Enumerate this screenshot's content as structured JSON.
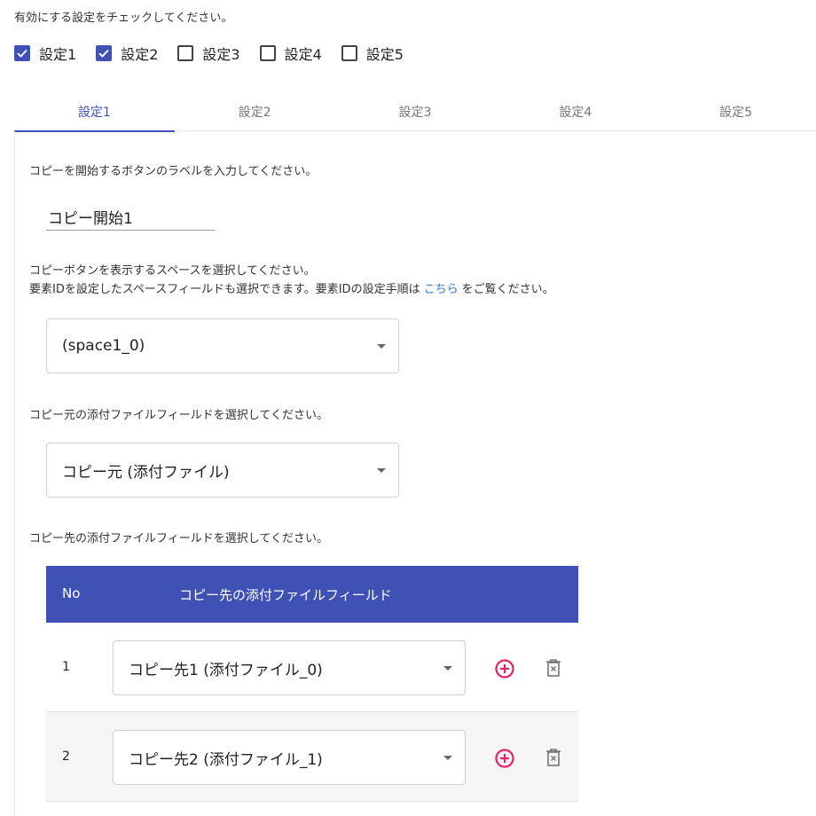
{
  "intro": "有効にする設定をチェックしてください。",
  "settings_checks": [
    {
      "label": "設定1",
      "checked": true
    },
    {
      "label": "設定2",
      "checked": true
    },
    {
      "label": "設定3",
      "checked": false
    },
    {
      "label": "設定4",
      "checked": false
    },
    {
      "label": "設定5",
      "checked": false
    }
  ],
  "tabs": [
    {
      "label": "設定1",
      "active": true
    },
    {
      "label": "設定2",
      "active": false
    },
    {
      "label": "設定3",
      "active": false
    },
    {
      "label": "設定4",
      "active": false
    },
    {
      "label": "設定5",
      "active": false
    }
  ],
  "form": {
    "button_label_prompt": "コピーを開始するボタンのラベルを入力してください。",
    "button_label_value": "コピー開始1",
    "space_prompt_line1": "コピーボタンを表示するスペースを選択してください。",
    "space_prompt_line2_before": "要素IDを設定したスペースフィールドも選択できます。要素IDの設定手順は",
    "space_prompt_link": "こちら",
    "space_prompt_line2_after": "をご覧ください。",
    "space_selected": "(space1_0)",
    "source_prompt": "コピー元の添付ファイルフィールドを選択してください。",
    "source_selected": "コピー元 (添付ファイル)",
    "dest_prompt": "コピー先の添付ファイルフィールドを選択してください。"
  },
  "dest_table": {
    "header_no": "No",
    "header_field": "コピー先の添付ファイルフィールド",
    "rows": [
      {
        "no": "1",
        "selected": "コピー先1 (添付ファイル_0)"
      },
      {
        "no": "2",
        "selected": "コピー先2 (添付ファイル_1)"
      }
    ]
  },
  "icons": {
    "checkbox_checked": "check-icon",
    "add": "plus-circle-icon",
    "delete": "trash-icon",
    "dropdown": "chevron-down-icon"
  },
  "colors": {
    "accent": "#3f51b5",
    "link": "#2f78c4",
    "add_icon": "#e91e63",
    "delete_icon": "#757575"
  }
}
